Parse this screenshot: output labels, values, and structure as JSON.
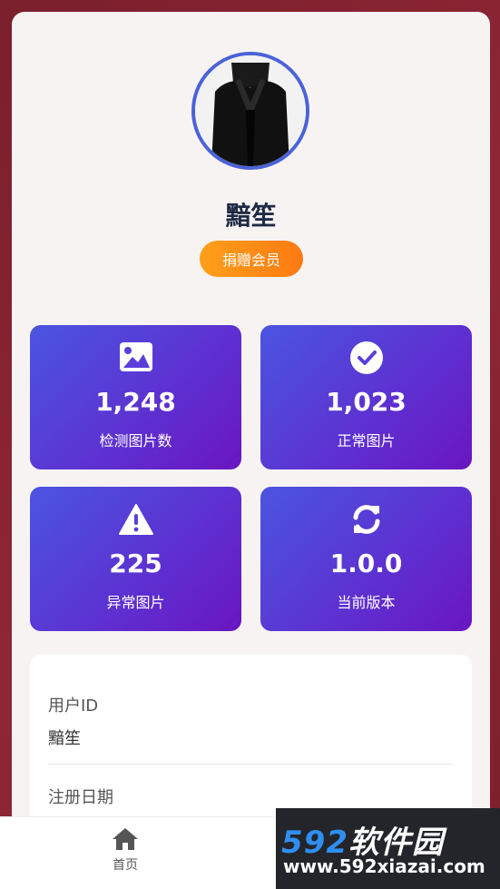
{
  "profile": {
    "username": "黯笙",
    "badge": "捐赠会员"
  },
  "stats": [
    {
      "icon": "image-icon",
      "value": "1,248",
      "label": "检测图片数"
    },
    {
      "icon": "check-circle-icon",
      "value": "1,023",
      "label": "正常图片"
    },
    {
      "icon": "warning-icon",
      "value": "225",
      "label": "异常图片"
    },
    {
      "icon": "refresh-icon",
      "value": "1.0.0",
      "label": "当前版本"
    }
  ],
  "info": {
    "user_id_label": "用户ID",
    "user_id_value": "黯笙",
    "register_label": "注册日期"
  },
  "tabbar": {
    "home_label": "首页"
  },
  "watermark": {
    "brand_num": "592",
    "brand_cn": "软件园",
    "url": "www.592xiazai.com"
  },
  "colors": {
    "accent": "#4a62d8",
    "badge": "#ff8c18",
    "stat_gradient_start": "#4a55e0",
    "stat_gradient_end": "#6a15c0"
  }
}
